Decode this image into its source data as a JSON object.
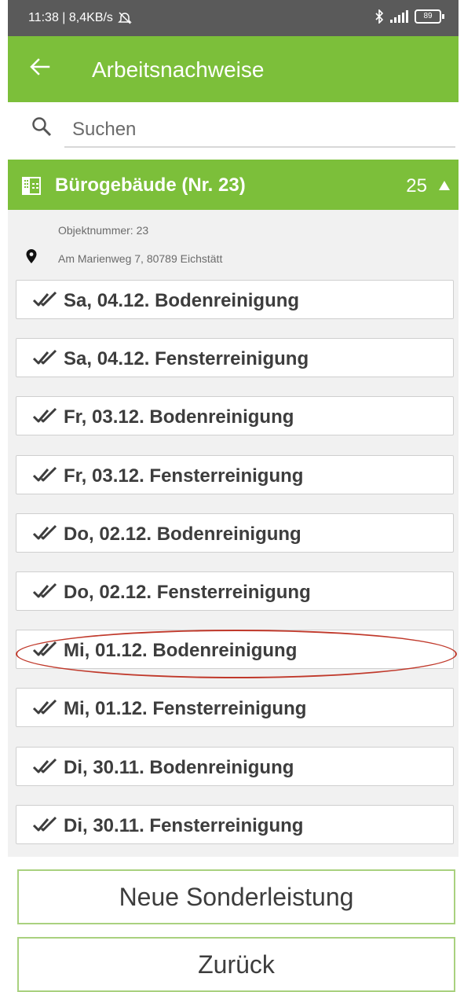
{
  "status_bar": {
    "left_text": "11:38 | 8,4KB/s",
    "battery": "89"
  },
  "app_bar": {
    "title": "Arbeitsnachweise"
  },
  "search": {
    "placeholder": "Suchen"
  },
  "group": {
    "title": "Bürogebäude (Nr. 23)",
    "count": "25",
    "object_number": "Objektnummer: 23",
    "address": "Am Marienweg 7, 80789 Eichstätt",
    "entries": [
      {
        "label": "Sa, 04.12. Bodenreinigung"
      },
      {
        "label": "Sa, 04.12. Fensterreinigung"
      },
      {
        "label": "Fr, 03.12. Bodenreinigung"
      },
      {
        "label": "Fr, 03.12. Fensterreinigung"
      },
      {
        "label": "Do, 02.12. Bodenreinigung"
      },
      {
        "label": "Do, 02.12. Fensterreinigung"
      },
      {
        "label": "Mi, 01.12. Bodenreinigung"
      },
      {
        "label": "Mi, 01.12. Fensterreinigung"
      },
      {
        "label": "Di, 30.11. Bodenreinigung"
      },
      {
        "label": "Di, 30.11. Fensterreinigung"
      }
    ]
  },
  "buttons": {
    "new_label": "Neue Sonderleistung",
    "back_label": "Zurück"
  },
  "colors": {
    "accent": "#7cbf3a",
    "highlight": "#c0392b",
    "button_border": "#a9d17f"
  }
}
